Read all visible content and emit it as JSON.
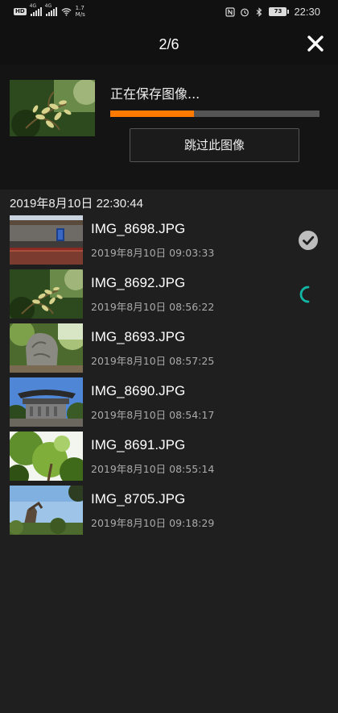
{
  "status_bar": {
    "hd_badge": "HD",
    "sim1_tag": "4G",
    "sim2_tag": "4G",
    "speed_value": "1.7",
    "speed_unit": "M/s",
    "battery": "73",
    "time": "22:30",
    "icons": [
      "nfc-icon",
      "alarm-icon",
      "bluetooth-icon",
      "battery-icon",
      "wifi-icon",
      "signal-icon"
    ]
  },
  "header": {
    "counter": "2/6",
    "close_icon": "close-icon"
  },
  "progress": {
    "message": "正在保存图像...",
    "fraction": 0.4,
    "skip_label": "跳过此图像",
    "bar_color": "#ff7a00"
  },
  "group": {
    "date": "2019年8月10日 22:30:44"
  },
  "files": [
    {
      "name": "IMG_8698.JPG",
      "time": "2019年8月10日 09:03:33",
      "status": "done"
    },
    {
      "name": "IMG_8692.JPG",
      "time": "2019年8月10日 08:56:22",
      "status": "saving"
    },
    {
      "name": "IMG_8693.JPG",
      "time": "2019年8月10日 08:57:25",
      "status": "pending"
    },
    {
      "name": "IMG_8690.JPG",
      "time": "2019年8月10日 08:54:17",
      "status": "pending"
    },
    {
      "name": "IMG_8691.JPG",
      "time": "2019年8月10日 08:55:14",
      "status": "pending"
    },
    {
      "name": "IMG_8705.JPG",
      "time": "2019年8月10日 09:18:29",
      "status": "pending"
    }
  ],
  "colors": {
    "accent": "#ff7a00",
    "spinner": "#13b5a5",
    "check": "#bdbdbd"
  }
}
